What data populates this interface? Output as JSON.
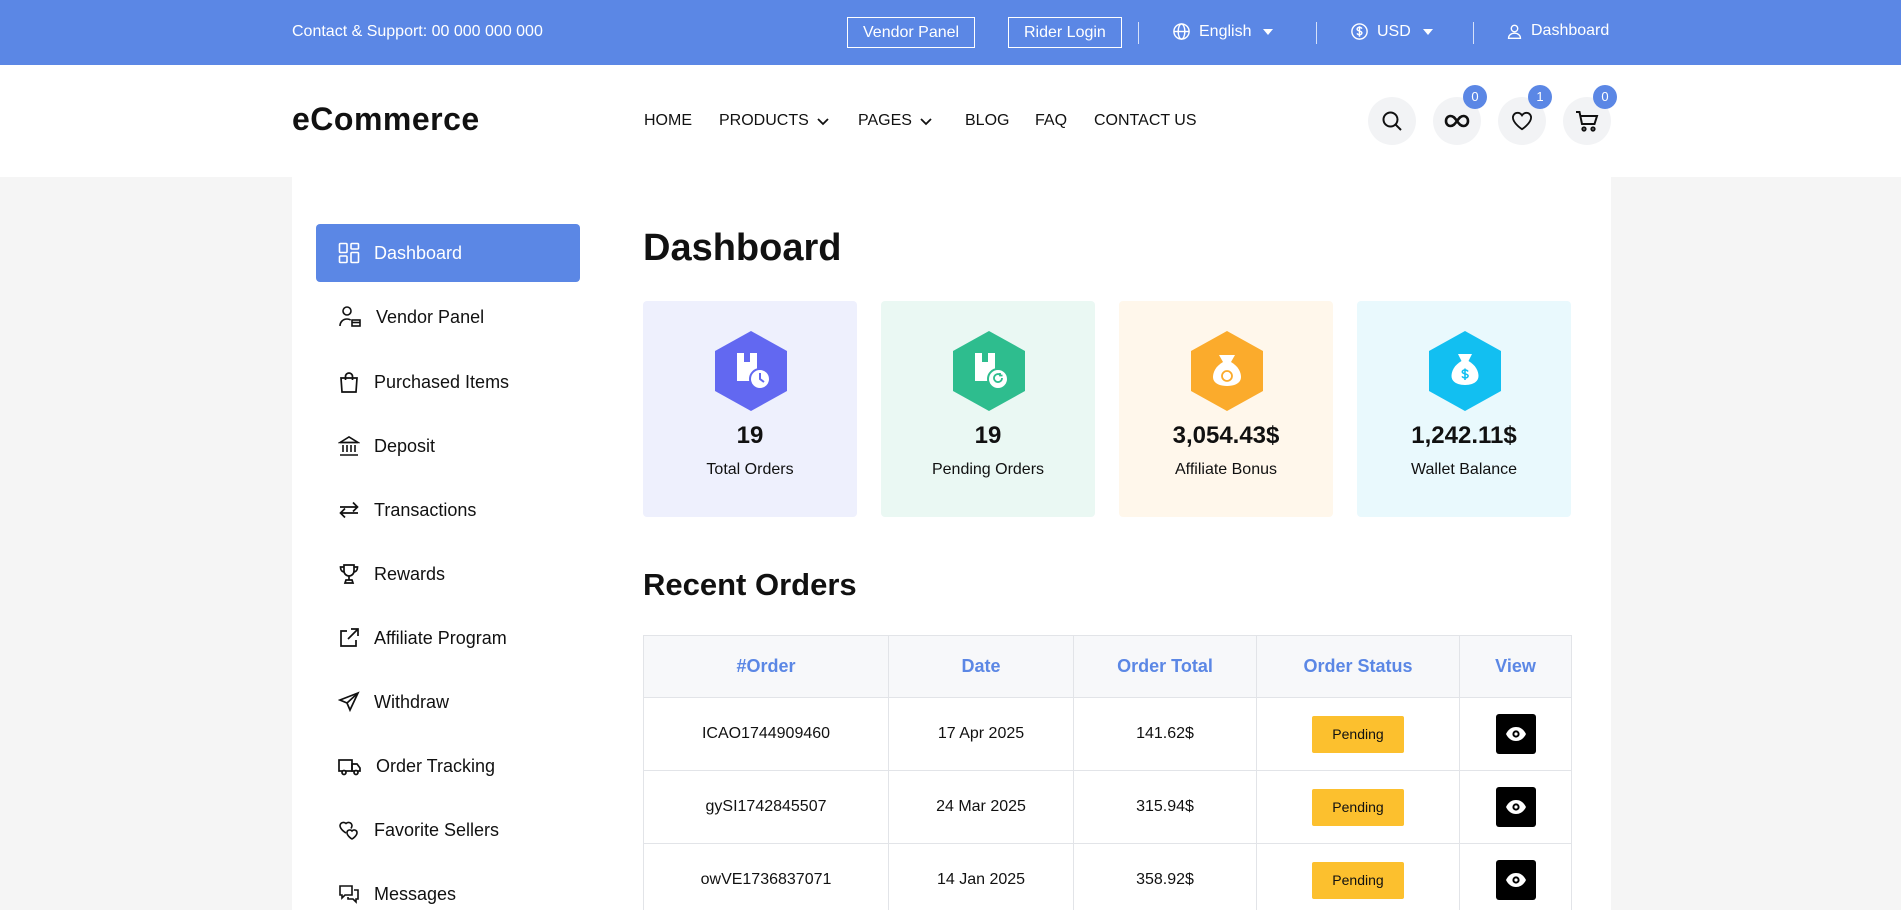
{
  "topbar": {
    "contact": "Contact & Support: 00 000 000 000",
    "vendor_panel": "Vendor Panel",
    "rider_login": "Rider Login",
    "language": "English",
    "currency": "USD",
    "dashboard": "Dashboard"
  },
  "header": {
    "logo": "eCommerce",
    "nav": {
      "home": "HOME",
      "products": "PRODUCTS",
      "pages": "PAGES",
      "blog": "BLOG",
      "faq": "FAQ",
      "contact": "CONTACT US"
    },
    "badges": {
      "compare": "0",
      "wishlist": "1",
      "cart": "0"
    }
  },
  "sidebar": {
    "items": [
      {
        "label": "Dashboard",
        "icon": "grid-icon"
      },
      {
        "label": "Vendor Panel",
        "icon": "user-store-icon"
      },
      {
        "label": "Purchased Items",
        "icon": "bag-icon"
      },
      {
        "label": "Deposit",
        "icon": "bank-icon"
      },
      {
        "label": "Transactions",
        "icon": "swap-icon"
      },
      {
        "label": "Rewards",
        "icon": "trophy-icon"
      },
      {
        "label": "Affiliate Program",
        "icon": "external-link-icon"
      },
      {
        "label": "Withdraw",
        "icon": "send-icon"
      },
      {
        "label": "Order Tracking",
        "icon": "truck-icon"
      },
      {
        "label": "Favorite Sellers",
        "icon": "hearts-icon"
      },
      {
        "label": "Messages",
        "icon": "chat-icon"
      }
    ]
  },
  "main": {
    "title": "Dashboard",
    "stats": [
      {
        "value": "19",
        "label": "Total Orders",
        "bg": "#eef0fd",
        "color": "#6268f1"
      },
      {
        "value": "19",
        "label": "Pending Orders",
        "bg": "#eaf8f3",
        "color": "#2ebd8e"
      },
      {
        "value": "3,054.43$",
        "label": "Affiliate Bonus",
        "bg": "#fff7eb",
        "color": "#fbab2c"
      },
      {
        "value": "1,242.11$",
        "label": "Wallet Balance",
        "bg": "#e9f9fd",
        "color": "#12bff1"
      }
    ],
    "recent_title": "Recent Orders",
    "table": {
      "headers": [
        "#Order",
        "Date",
        "Order Total",
        "Order Status",
        "View"
      ],
      "rows": [
        {
          "order": "ICAO1744909460",
          "date": "17 Apr 2025",
          "total": "141.62$",
          "status": "Pending"
        },
        {
          "order": "gySI1742845507",
          "date": "24 Mar 2025",
          "total": "315.94$",
          "status": "Pending"
        },
        {
          "order": "owVE1736837071",
          "date": "14 Jan 2025",
          "total": "358.92$",
          "status": "Pending"
        }
      ]
    }
  },
  "colors": {
    "accent": "#5b87e5",
    "pending": "#fcc02e"
  }
}
